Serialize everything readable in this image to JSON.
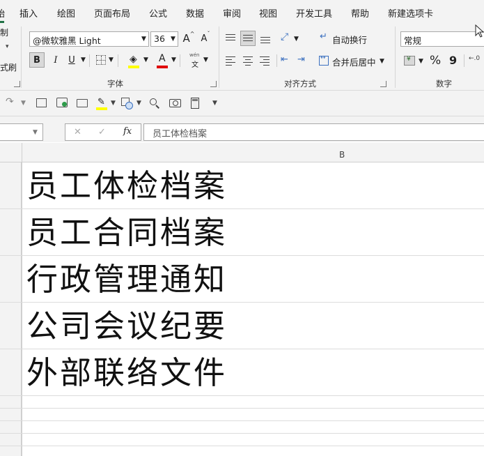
{
  "menu": {
    "tabs": [
      "始",
      "插入",
      "绘图",
      "页面布局",
      "公式",
      "数据",
      "审阅",
      "视图",
      "开发工具",
      "帮助",
      "新建选项卡"
    ]
  },
  "clipboard": {
    "copy_fragment": "制",
    "format_painter_fragment": "式刷"
  },
  "font_group": {
    "label": "字体",
    "font_name": "@微软雅黑 Light",
    "font_size": "36",
    "grow_label": "A",
    "shrink_label": "A",
    "bold": "B",
    "italic": "I",
    "underline": "U",
    "font_color_letter": "A",
    "fill_color": "#ffff00",
    "font_color": "#e00000",
    "wen_label": "wén",
    "wen_char": "文"
  },
  "align_group": {
    "label": "对齐方式",
    "wrap_text": "自动换行",
    "merge_center": "合并后居中"
  },
  "number_group": {
    "label": "数字",
    "format": "常规",
    "percent": "%",
    "comma": "9"
  },
  "formula_bar": {
    "fx": "fx",
    "cancel": "✕",
    "enter": "✓",
    "content": "员工体检档案"
  },
  "sheet": {
    "column_b": "B",
    "cells": [
      "员工体检档案",
      "员工合同档案",
      "行政管理通知",
      "公司会议纪要",
      "外部联络文件"
    ]
  }
}
